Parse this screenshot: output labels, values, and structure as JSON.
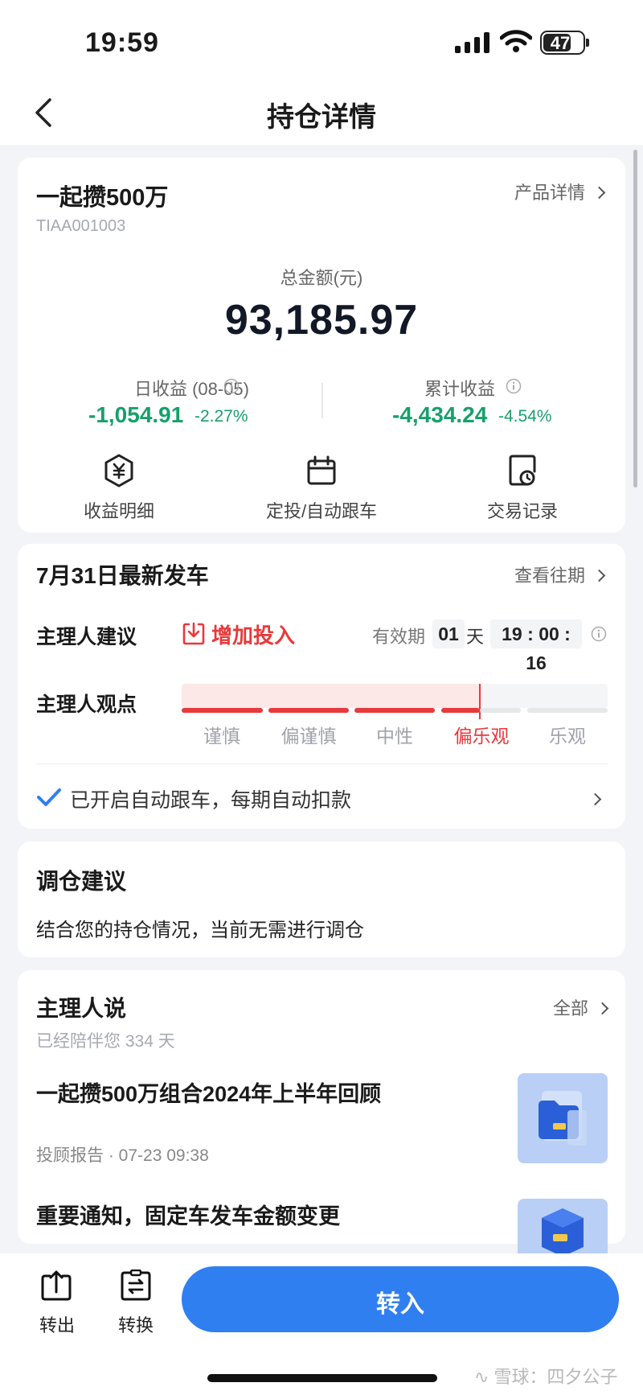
{
  "status_bar": {
    "time": "19:59",
    "battery": "47"
  },
  "header": {
    "title": "持仓详情"
  },
  "holding": {
    "name": "一起攒500万",
    "code": "TIAA001003",
    "detail_link": "产品详情",
    "total_label": "总金额(元)",
    "total_value": "93,185.97",
    "daily_label": "日收益 (08-05)",
    "daily_value": "-1,054.91",
    "daily_pct": "-2.27%",
    "cumulative_label": "累计收益",
    "cumulative_value": "-4,434.24",
    "cumulative_pct": "-4.54%",
    "actions": [
      {
        "label": "收益明细",
        "icon": "yuan-hexagon-icon"
      },
      {
        "label": "定投/自动跟车",
        "icon": "calendar-icon"
      },
      {
        "label": "交易记录",
        "icon": "clock-document-icon"
      }
    ]
  },
  "launch": {
    "title": "7月31日最新发车",
    "history_link": "查看往期",
    "advice_label": "主理人建议",
    "advice_value": "增加投入",
    "validity_label": "有效期",
    "days": "01",
    "days_unit": "天",
    "hh": "19",
    "mm": "00",
    "ss": "16",
    "view_label": "主理人观点",
    "levels": [
      "谨慎",
      "偏谨慎",
      "中性",
      "偏乐观",
      "乐观"
    ],
    "selected_level": "偏乐观",
    "auto_follow": "已开启自动跟车，每期自动扣款"
  },
  "rebalance": {
    "title": "调仓建议",
    "text": "结合您的持仓情况，当前无需进行调仓"
  },
  "manager": {
    "title": "主理人说",
    "all_link": "全部",
    "accompany": "已经陪伴您 334 天",
    "posts": [
      {
        "title": "一起攒500万组合2024年上半年回顾",
        "meta": "投顾报告 · 07-23 09:38"
      },
      {
        "title": "重要通知，固定车发车金额变更"
      }
    ]
  },
  "bottom_bar": {
    "transfer_out": "转出",
    "convert": "转换",
    "transfer_in": "转入"
  },
  "watermark": "雪球：四夕公子",
  "colors": {
    "accent_blue": "#2f7ff0",
    "loss_green": "#18a06a",
    "highlight_red": "#e8393b"
  }
}
